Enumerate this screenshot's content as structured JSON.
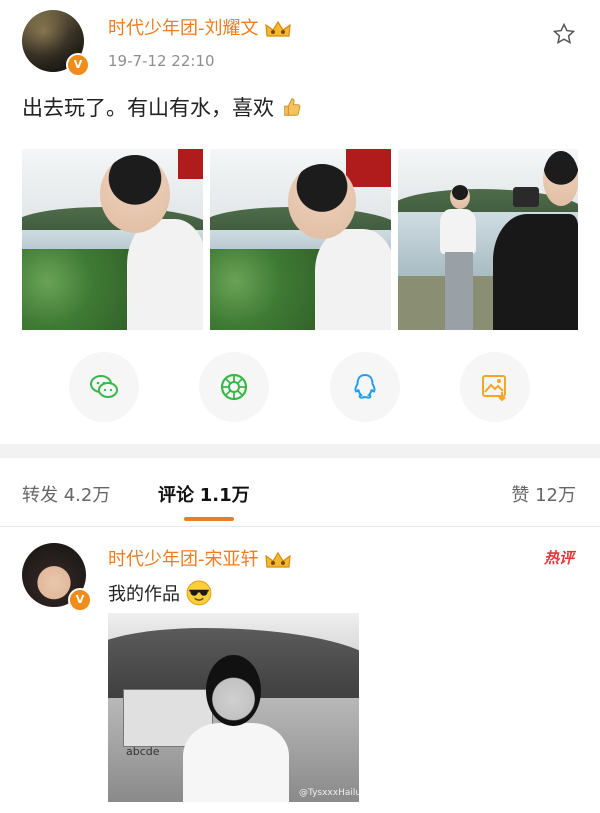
{
  "post": {
    "username": "时代少年团-刘耀文",
    "timestamp": "19-7-12 22:10",
    "text": "出去玩了。有山有水，喜欢",
    "verified_badge": "V",
    "emoji_icon": "thumbs-up-icon"
  },
  "share_buttons": [
    {
      "name": "wechat",
      "icon": "wechat-icon",
      "color": "#3cb54a"
    },
    {
      "name": "moments",
      "icon": "moments-icon",
      "color": "#3cb54a"
    },
    {
      "name": "qq",
      "icon": "qq-icon",
      "color": "#1e9ff2"
    },
    {
      "name": "save-image",
      "icon": "save-image-icon",
      "color": "#f5a623"
    }
  ],
  "tabs": {
    "repost": {
      "label": "转发",
      "count": "4.2万"
    },
    "comments": {
      "label": "评论",
      "count": "1.1万"
    },
    "likes": {
      "label": "赞",
      "count": "12万"
    }
  },
  "comment": {
    "username": "时代少年团-宋亚轩",
    "badge": "热评",
    "text": "我的作品",
    "verified_badge": "V",
    "shirt_text": "abcde",
    "watermark": "@TysxxxHailunHd"
  },
  "colors": {
    "accent": "#f07c1e",
    "hot": "#e8363a",
    "muted": "#8e8e8e"
  }
}
